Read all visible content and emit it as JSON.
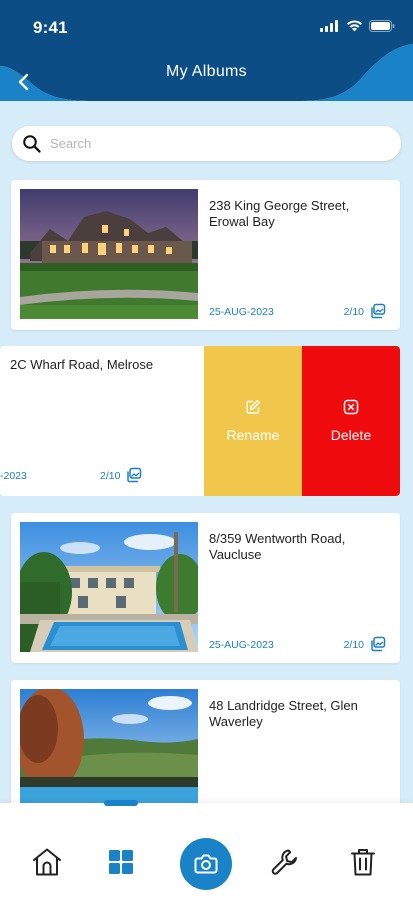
{
  "status_bar": {
    "time": "9:41"
  },
  "header": {
    "title": "My Albums"
  },
  "search": {
    "placeholder": "Search"
  },
  "albums": [
    {
      "title": "238 King George Street, Erowal Bay",
      "date": "25-AUG-2023",
      "count": "2/10"
    },
    {
      "title": "2C Wharf Road, Melrose",
      "date": "-2023",
      "count": "2/10"
    },
    {
      "title": "8/359 Wentworth Road, Vaucluse",
      "date": "25-AUG-2023",
      "count": "2/10"
    },
    {
      "title": "48 Landridge Street, Glen Waverley",
      "date": "",
      "count": ""
    }
  ],
  "swipe_actions": {
    "rename": "Rename",
    "delete": "Delete"
  },
  "bottom_nav": {
    "items": [
      "home-icon",
      "albums-grid-icon",
      "camera-icon",
      "wrench-icon",
      "trash-icon"
    ],
    "active": "albums-grid-icon"
  },
  "colors": {
    "primary": "#1a82c7",
    "header_dark": "#0d4d86",
    "background": "#d6edf9",
    "rename": "#f0c74b",
    "delete": "#ef0a0d"
  }
}
